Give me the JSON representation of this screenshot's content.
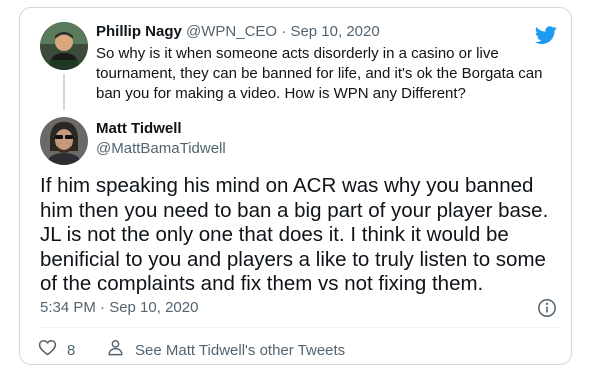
{
  "parent_tweet": {
    "name": "Phillip Nagy",
    "handle": "@WPN_CEO",
    "separator": "·",
    "date": "Sep 10, 2020",
    "text": "So why is it when someone acts disorderly in a casino or live tournament, they can be banned for life, and it's ok the Borgata can ban you for making a video. How is WPN any Different?"
  },
  "main_tweet": {
    "name": "Matt Tidwell",
    "handle": "@MattBamaTidwell",
    "text": "If him speaking his mind on ACR was why you banned him then you need to ban a big part of your player base. JL is not the only one that does it. I think it would be benificial to you and players a like to truly listen to some of the complaints and fix them vs not fixing them.",
    "timestamp": "5:34 PM · Sep 10, 2020"
  },
  "actions": {
    "like_count": "8",
    "other_tweets_label": "See Matt Tidwell's other Tweets"
  },
  "icons": {
    "brand": "twitter-bird-icon",
    "info": "info-icon",
    "like": "heart-icon",
    "profile": "person-icon"
  },
  "colors": {
    "brand": "#1d9bf0",
    "text": "#0f1419",
    "muted": "#536471",
    "border": "#cfd9de"
  }
}
